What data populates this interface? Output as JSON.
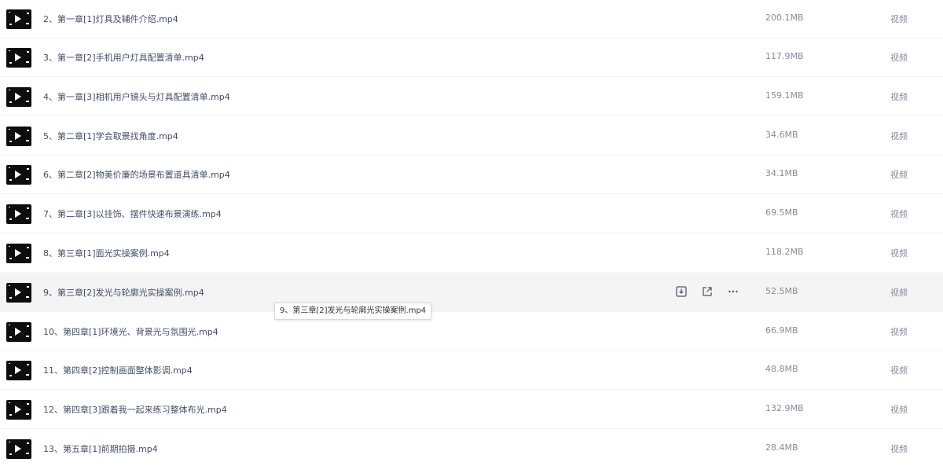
{
  "files": [
    {
      "name": "2、第一章[1]灯具及辅件介绍.mp4",
      "size": "200.1MB",
      "type": "视频"
    },
    {
      "name": "3、第一章[2]手机用户灯具配置清单.mp4",
      "size": "117.9MB",
      "type": "视频"
    },
    {
      "name": "4、第一章[3]相机用户镜头与灯具配置清单.mp4",
      "size": "159.1MB",
      "type": "视频"
    },
    {
      "name": "5、第二章[1]学会取景找角度.mp4",
      "size": "34.6MB",
      "type": "视频"
    },
    {
      "name": "6、第二章[2]物美价廉的场景布置道具清单.mp4",
      "size": "34.1MB",
      "type": "视频"
    },
    {
      "name": "7、第二章[3]以挂饰、摆件快速布景演练.mp4",
      "size": "69.5MB",
      "type": "视频"
    },
    {
      "name": "8、第三章[1]面光实操案例.mp4",
      "size": "118.2MB",
      "type": "视频"
    },
    {
      "name": "9、第三章[2]发光与轮廓光实操案例.mp4",
      "size": "52.5MB",
      "type": "视频"
    },
    {
      "name": "10、第四章[1]环境光、背景光与氛围光.mp4",
      "size": "66.9MB",
      "type": "视频"
    },
    {
      "name": "11、第四章[2]控制画面整体影调.mp4",
      "size": "48.8MB",
      "type": "视频"
    },
    {
      "name": "12、第四章[3]跟着我一起来练习整体布光.mp4",
      "size": "132.9MB",
      "type": "视频"
    },
    {
      "name": "13、第五章[1]前期拍摄.mp4",
      "size": "28.4MB",
      "type": "视频"
    }
  ],
  "hovered_index": 7,
  "row_actions": [
    {
      "icon": "download-icon"
    },
    {
      "icon": "share-icon"
    },
    {
      "icon": "more-icon"
    }
  ],
  "tooltip": {
    "text": "9、第三章[2]发光与轮廓光实操案例.mp4"
  },
  "colors": {
    "hover_bg": "#f4f4f5",
    "name_text": "#424e67",
    "meta_text": "#878c9c",
    "thumb_bg": "#0d0d0d"
  }
}
